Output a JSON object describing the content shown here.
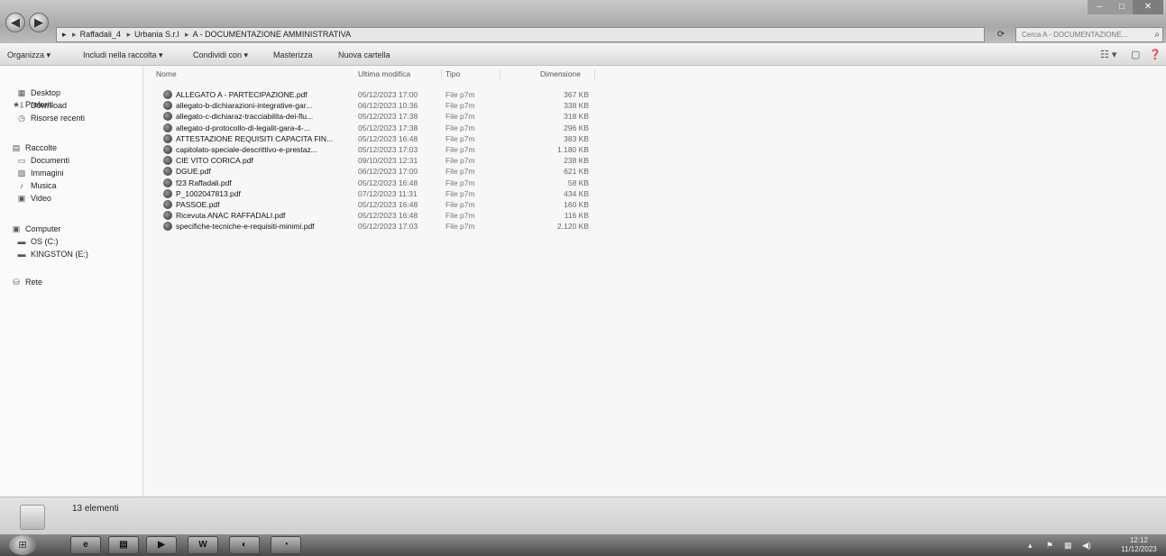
{
  "address": {
    "segments": [
      "Raffadali_4",
      "Urbania S.r.l",
      "A - DOCUMENTAZIONE AMMINISTRATIVA"
    ],
    "search_placeholder": "Cerca A - DOCUMENTAZIONE..."
  },
  "toolbar": {
    "organize": "Organizza ▾",
    "include": "Includi nella raccolta ▾",
    "share": "Condividi con ▾",
    "burn": "Masterizza",
    "new_folder": "Nuova cartella"
  },
  "sidebar": {
    "favorites": "Preferiti",
    "desktop": "Desktop",
    "download": "Download",
    "recent": "Risorse recenti",
    "libraries": "Raccolte",
    "documents": "Documenti",
    "pictures": "Immagini",
    "music": "Musica",
    "video": "Video",
    "computer": "Computer",
    "os": "OS (C:)",
    "kingston": "KINGSTON (E:)",
    "network": "Rete"
  },
  "columns": {
    "name": "Nome",
    "modified": "Ultima modifica",
    "type": "Tipo",
    "size": "Dimensione"
  },
  "files": [
    {
      "name": "ALLEGATO A - PARTECIPAZIONE.pdf",
      "date": "05/12/2023 17:00",
      "type": "File p7m",
      "size": "367 KB"
    },
    {
      "name": "allegato-b-dichiarazioni-integrative-gar...",
      "date": "06/12/2023 10:36",
      "type": "File p7m",
      "size": "338 KB"
    },
    {
      "name": "allegato-c-dichiaraz-tracciabilita-dei-flu...",
      "date": "05/12/2023 17:38",
      "type": "File p7m",
      "size": "318 KB"
    },
    {
      "name": "allegato-d-protocollo-di-legalit-gara-4-...",
      "date": "05/12/2023 17:38",
      "type": "File p7m",
      "size": "296 KB"
    },
    {
      "name": "ATTESTAZIONE REQUISITI CAPACITA FIN...",
      "date": "05/12/2023 16:48",
      "type": "File p7m",
      "size": "383 KB"
    },
    {
      "name": "capitolato-speciale-descrittivo-e-prestaz...",
      "date": "05/12/2023 17:03",
      "type": "File p7m",
      "size": "1.180 KB"
    },
    {
      "name": "CIE VITO CORICA.pdf",
      "date": "09/10/2023 12:31",
      "type": "File p7m",
      "size": "238 KB"
    },
    {
      "name": "DGUE.pdf",
      "date": "06/12/2023 17:00",
      "type": "File p7m",
      "size": "621 KB"
    },
    {
      "name": "f23 Raffadali.pdf",
      "date": "05/12/2023 16:48",
      "type": "File p7m",
      "size": "58 KB"
    },
    {
      "name": "P_1002047813.pdf",
      "date": "07/12/2023 11:31",
      "type": "File p7m",
      "size": "434 KB"
    },
    {
      "name": "PASSOE.pdf",
      "date": "05/12/2023 16:48",
      "type": "File p7m",
      "size": "160 KB"
    },
    {
      "name": "Ricevuta ANAC RAFFADALI.pdf",
      "date": "05/12/2023 16:48",
      "type": "File p7m",
      "size": "116 KB"
    },
    {
      "name": "specifiche-tecniche-e-requisiti-minimi.pdf",
      "date": "05/12/2023 17:03",
      "type": "File p7m",
      "size": "2.120 KB"
    }
  ],
  "status": {
    "count": "13 elementi"
  },
  "taskbar": {
    "word_label": "W",
    "clock_time": "12:12",
    "clock_date": "11/12/2023"
  }
}
